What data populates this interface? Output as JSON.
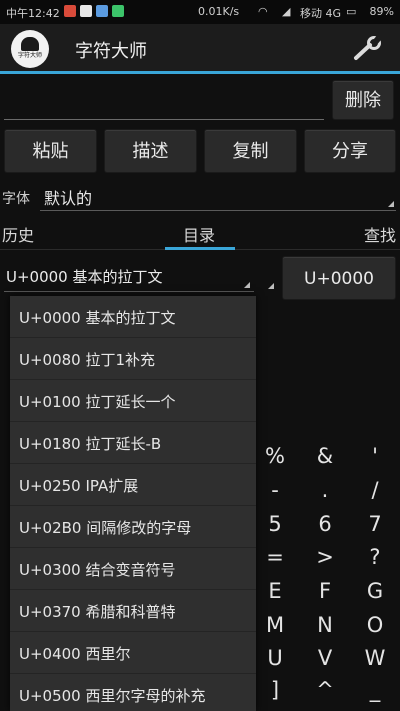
{
  "status_bar": {
    "time": "中午12:42",
    "network_speed": "0.01K/s",
    "carrier": "移动 4G",
    "battery": "89%"
  },
  "app": {
    "title": "字符大师",
    "icon_text": "字符大师",
    "accent_color": "#3aa6d8"
  },
  "toolbar": {
    "delete_label": "删除",
    "buttons": [
      "粘贴",
      "描述",
      "复制",
      "分享"
    ]
  },
  "font_row": {
    "label": "字体",
    "value": "默认的"
  },
  "tabs": [
    "历史",
    "目录",
    "查找"
  ],
  "active_tab": "目录",
  "block_select": {
    "value": "U+0000 基本的拉丁文",
    "code_button": "U+0000"
  },
  "dropdown_items": [
    "U+0000 基本的拉丁文",
    "U+0080 拉丁1补充",
    "U+0100 拉丁延长一个",
    "U+0180 拉丁延长-B",
    "U+0250 IPA扩展",
    "U+02B0 间隔修改的字母",
    "U+0300 结合变音符号",
    "U+0370 希腊和科普特",
    "U+0400 西里尔",
    "U+0500 西里尔字母的补充"
  ],
  "char_grid": [
    [
      "%",
      "&",
      "'"
    ],
    [
      "-",
      ".",
      "/"
    ],
    [
      "5",
      "6",
      "7"
    ],
    [
      "=",
      ">",
      "?"
    ],
    [
      "E",
      "F",
      "G"
    ],
    [
      "M",
      "N",
      "O"
    ],
    [
      "U",
      "V",
      "W"
    ],
    [
      "]",
      "^",
      "_"
    ]
  ]
}
